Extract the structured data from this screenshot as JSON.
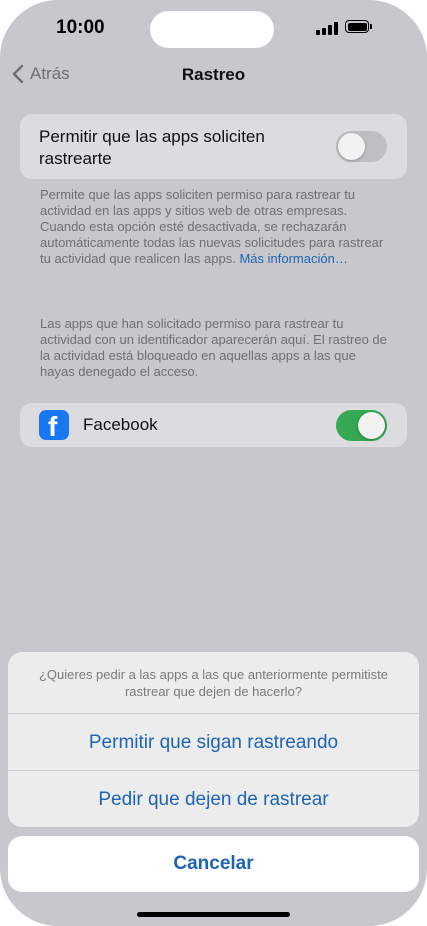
{
  "status_bar": {
    "time": "10:00"
  },
  "nav": {
    "back_label": "Atrás",
    "title": "Rastreo"
  },
  "allow_tracking": {
    "label": "Permitir que las apps soliciten rastrearte",
    "toggle_on": false
  },
  "footnote1": {
    "text": "Permite que las apps soliciten permiso para rastrear tu actividad en las apps y sitios web de otras empresas. Cuando esta opción esté desactivada, se rechazarán automáticamente todas las nuevas solicitudes para rastrear tu actividad que realicen las apps. ",
    "link": "Más información…"
  },
  "footnote2": {
    "text": "Las apps que han solicitado permiso para rastrear tu actividad con un identificador aparecerán aquí. El rastreo de la actividad está bloqueado en aquellas apps a las que hayas denegado el acceso."
  },
  "apps": [
    {
      "name": "Facebook",
      "icon": "facebook-icon",
      "toggle_on": true
    }
  ],
  "action_sheet": {
    "message": "¿Quieres pedir a las apps a las que anteriormente permitiste rastrear que dejen de hacerlo?",
    "option_allow": "Permitir que sigan rastreando",
    "option_ask_stop": "Pedir que dejen de rastrear",
    "cancel": "Cancelar"
  },
  "colors": {
    "accent": "#1e64b4",
    "toggle_on": "#34a853",
    "facebook_blue": "#1877f2"
  }
}
